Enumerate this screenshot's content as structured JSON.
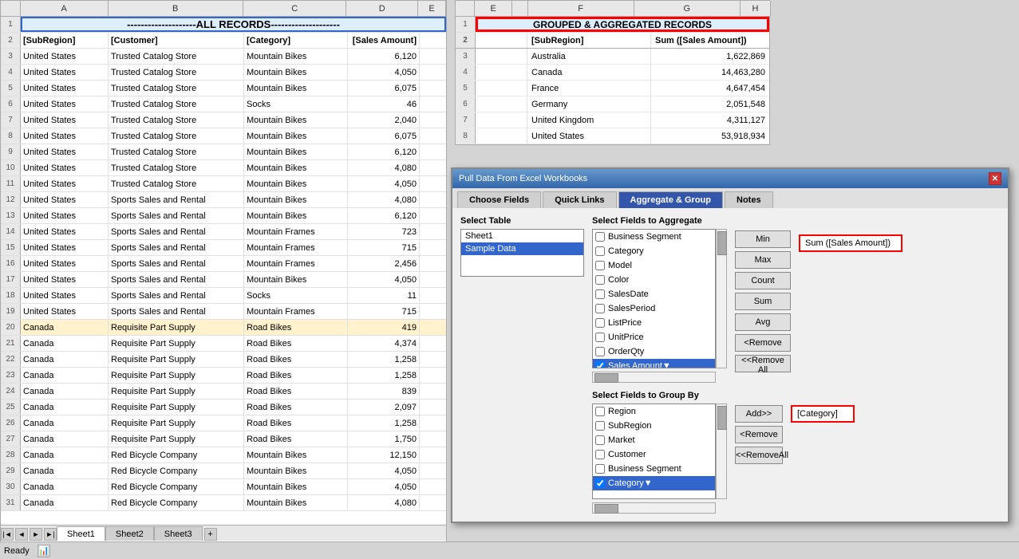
{
  "spreadsheet": {
    "all_records_banner": "--------------------ALL RECORDS--------------------",
    "columns": [
      "[SubRegion]",
      "[Customer]",
      "[Category]",
      "[Sales Amount]"
    ],
    "rows": [
      {
        "num": 3,
        "subregion": "United States",
        "customer": "Trusted Catalog Store",
        "category": "Mountain Bikes",
        "sales": "6,120",
        "highlight": false
      },
      {
        "num": 4,
        "subregion": "United States",
        "customer": "Trusted Catalog Store",
        "category": "Mountain Bikes",
        "sales": "4,050",
        "highlight": false
      },
      {
        "num": 5,
        "subregion": "United States",
        "customer": "Trusted Catalog Store",
        "category": "Mountain Bikes",
        "sales": "6,075",
        "highlight": false
      },
      {
        "num": 6,
        "subregion": "United States",
        "customer": "Trusted Catalog Store",
        "category": "Socks",
        "sales": "46",
        "highlight": false
      },
      {
        "num": 7,
        "subregion": "United States",
        "customer": "Trusted Catalog Store",
        "category": "Mountain Bikes",
        "sales": "2,040",
        "highlight": false
      },
      {
        "num": 8,
        "subregion": "United States",
        "customer": "Trusted Catalog Store",
        "category": "Mountain Bikes",
        "sales": "6,075",
        "highlight": false
      },
      {
        "num": 9,
        "subregion": "United States",
        "customer": "Trusted Catalog Store",
        "category": "Mountain Bikes",
        "sales": "6,120",
        "highlight": false
      },
      {
        "num": 10,
        "subregion": "United States",
        "customer": "Trusted Catalog Store",
        "category": "Mountain Bikes",
        "sales": "4,080",
        "highlight": false
      },
      {
        "num": 11,
        "subregion": "United States",
        "customer": "Trusted Catalog Store",
        "category": "Mountain Bikes",
        "sales": "4,050",
        "highlight": false
      },
      {
        "num": 12,
        "subregion": "United States",
        "customer": "Sports Sales and Rental",
        "category": "Mountain Bikes",
        "sales": "4,080",
        "highlight": false
      },
      {
        "num": 13,
        "subregion": "United States",
        "customer": "Sports Sales and Rental",
        "category": "Mountain Bikes",
        "sales": "6,120",
        "highlight": false
      },
      {
        "num": 14,
        "subregion": "United States",
        "customer": "Sports Sales and Rental",
        "category": "Mountain Frames",
        "sales": "723",
        "highlight": false
      },
      {
        "num": 15,
        "subregion": "United States",
        "customer": "Sports Sales and Rental",
        "category": "Mountain Frames",
        "sales": "715",
        "highlight": false
      },
      {
        "num": 16,
        "subregion": "United States",
        "customer": "Sports Sales and Rental",
        "category": "Mountain Frames",
        "sales": "2,456",
        "highlight": false
      },
      {
        "num": 17,
        "subregion": "United States",
        "customer": "Sports Sales and Rental",
        "category": "Mountain Bikes",
        "sales": "4,050",
        "highlight": false
      },
      {
        "num": 18,
        "subregion": "United States",
        "customer": "Sports Sales and Rental",
        "category": "Socks",
        "sales": "11",
        "highlight": false
      },
      {
        "num": 19,
        "subregion": "United States",
        "customer": "Sports Sales and Rental",
        "category": "Mountain Frames",
        "sales": "715",
        "highlight": false
      },
      {
        "num": 20,
        "subregion": "Canada",
        "customer": "Requisite Part Supply",
        "category": "Road Bikes",
        "sales": "419",
        "highlight": true
      },
      {
        "num": 21,
        "subregion": "Canada",
        "customer": "Requisite Part Supply",
        "category": "Road Bikes",
        "sales": "4,374",
        "highlight": false
      },
      {
        "num": 22,
        "subregion": "Canada",
        "customer": "Requisite Part Supply",
        "category": "Road Bikes",
        "sales": "1,258",
        "highlight": false
      },
      {
        "num": 23,
        "subregion": "Canada",
        "customer": "Requisite Part Supply",
        "category": "Road Bikes",
        "sales": "1,258",
        "highlight": false
      },
      {
        "num": 24,
        "subregion": "Canada",
        "customer": "Requisite Part Supply",
        "category": "Road Bikes",
        "sales": "839",
        "highlight": false
      },
      {
        "num": 25,
        "subregion": "Canada",
        "customer": "Requisite Part Supply",
        "category": "Road Bikes",
        "sales": "2,097",
        "highlight": false
      },
      {
        "num": 26,
        "subregion": "Canada",
        "customer": "Requisite Part Supply",
        "category": "Road Bikes",
        "sales": "1,258",
        "highlight": false
      },
      {
        "num": 27,
        "subregion": "Canada",
        "customer": "Requisite Part Supply",
        "category": "Road Bikes",
        "sales": "1,750",
        "highlight": false
      },
      {
        "num": 28,
        "subregion": "Canada",
        "customer": "Red Bicycle Company",
        "category": "Mountain Bikes",
        "sales": "12,150",
        "highlight": false
      },
      {
        "num": 29,
        "subregion": "Canada",
        "customer": "Red Bicycle Company",
        "category": "Mountain Bikes",
        "sales": "4,050",
        "highlight": false
      },
      {
        "num": 30,
        "subregion": "Canada",
        "customer": "Red Bicycle Company",
        "category": "Mountain Bikes",
        "sales": "4,050",
        "highlight": false
      },
      {
        "num": 31,
        "subregion": "Canada",
        "customer": "Red Bicycle Company",
        "category": "Mountain Bikes",
        "sales": "4,080",
        "highlight": false
      }
    ],
    "sheets": [
      "Sheet1",
      "Sheet2",
      "Sheet3"
    ],
    "active_sheet": "Sheet1"
  },
  "grouped": {
    "banner": "GROUPED & AGGREGATED RECORDS",
    "col1_header": "[SubRegion]",
    "col2_header": "Sum ([Sales Amount])",
    "rows": [
      {
        "subregion": "Australia",
        "sales": "1,622,869"
      },
      {
        "subregion": "Canada",
        "sales": "14,463,280"
      },
      {
        "subregion": "France",
        "sales": "4,647,454"
      },
      {
        "subregion": "Germany",
        "sales": "2,051,548"
      },
      {
        "subregion": "United Kingdom",
        "sales": "4,311,127"
      },
      {
        "subregion": "United States",
        "sales": "53,918,934"
      }
    ]
  },
  "dialog": {
    "title": "Pull Data From Excel Workbooks",
    "tabs": [
      "Choose Fields",
      "Quick Links",
      "Aggregate & Group",
      "Notes"
    ],
    "active_tab": "Aggregate & Group",
    "select_table_label": "Select Table",
    "table_items": [
      "Sheet1",
      "Sample Data"
    ],
    "active_table": "Sample Data",
    "select_fields_aggregate_label": "Select Fields to Aggregate",
    "aggregate_fields": [
      {
        "label": "Business Segment",
        "checked": false
      },
      {
        "label": "Category",
        "checked": false
      },
      {
        "label": "Model",
        "checked": false
      },
      {
        "label": "Color",
        "checked": false
      },
      {
        "label": "SalesDate",
        "checked": false
      },
      {
        "label": "SalesPeriod",
        "checked": false
      },
      {
        "label": "ListPrice",
        "checked": false
      },
      {
        "label": "UnitPrice",
        "checked": false
      },
      {
        "label": "OrderQty",
        "checked": false
      },
      {
        "label": "Sales Amount",
        "checked": true
      }
    ],
    "agg_buttons": [
      "Min",
      "Max",
      "Count",
      "Sum",
      "Avg",
      "<Remove",
      "<<Remove All"
    ],
    "agg_result": "Sum ([Sales Amount])",
    "select_fields_group_label": "Select Fields to Group By",
    "group_fields": [
      {
        "label": "Region",
        "checked": false
      },
      {
        "label": "SubRegion",
        "checked": false
      },
      {
        "label": "Market",
        "checked": false
      },
      {
        "label": "Customer",
        "checked": false
      },
      {
        "label": "Business Segment",
        "checked": false
      },
      {
        "label": "Category",
        "checked": true
      }
    ],
    "group_buttons": [
      "Add>>",
      "<Remove",
      "<<RemoveAll"
    ],
    "group_result": "[Category]"
  },
  "status": {
    "ready_label": "Ready"
  }
}
